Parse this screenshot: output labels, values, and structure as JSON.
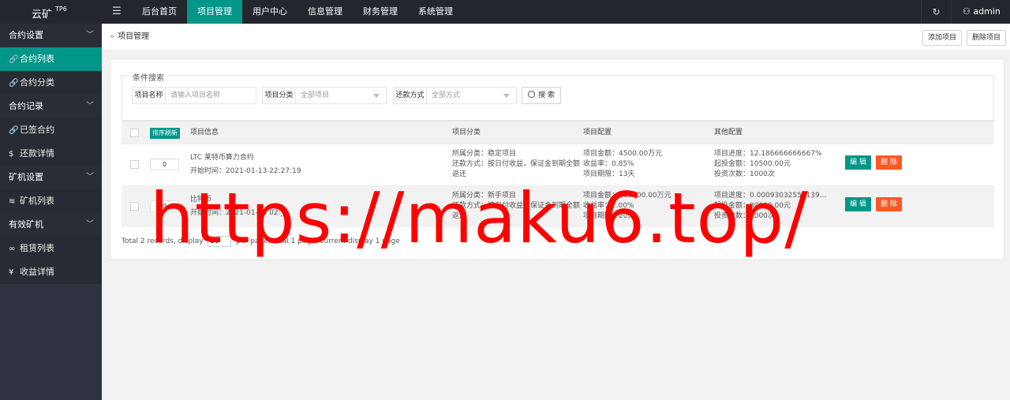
{
  "app": {
    "name": "云矿",
    "version": "TP6"
  },
  "topnav": {
    "toggle_icon": "menu-icon",
    "items": [
      {
        "label": "后台首页",
        "active": false
      },
      {
        "label": "项目管理",
        "active": true
      },
      {
        "label": "用户中心",
        "active": false
      },
      {
        "label": "信息管理",
        "active": false
      },
      {
        "label": "财务管理",
        "active": false
      },
      {
        "label": "系统管理",
        "active": false
      }
    ],
    "refresh_icon": "refresh-icon",
    "user": "admin"
  },
  "sidebar": {
    "groups": [
      {
        "label": "合约设置"
      },
      {
        "label": "合约记录"
      },
      {
        "label": "矿机设置"
      },
      {
        "label": "有效矿机"
      }
    ],
    "items": [
      {
        "label": "合约列表",
        "icon": "link-icon",
        "active": true
      },
      {
        "label": "合约分类",
        "icon": "link-icon"
      },
      {
        "label": "已签合约",
        "icon": "link-icon"
      },
      {
        "label": "还款详情",
        "icon": "dollar-icon"
      },
      {
        "label": "矿机列表",
        "icon": "stack-icon"
      },
      {
        "label": "租赁列表",
        "icon": "chain-icon"
      },
      {
        "label": "收益详情",
        "icon": "yen-icon"
      }
    ]
  },
  "breadcrumb": {
    "label": "项目管理"
  },
  "toolbar": {
    "add_label": "添加项目",
    "delete_label": "删除项目"
  },
  "search": {
    "legend": "条件搜索",
    "name_label": "项目名称",
    "name_placeholder": "请输入项目名称",
    "category_label": "项目分类",
    "category_value": "全部项目",
    "repay_label": "还款方式",
    "repay_value": "全部方式",
    "button_label": "搜 索"
  },
  "table": {
    "sort_badge": "排序刷新",
    "headers": [
      "项目信息",
      "项目分类",
      "项目配置",
      "其他配置"
    ],
    "rows": [
      {
        "sort": "0",
        "name": "LTC 莱特币算力合约",
        "start": "开始时间：2021-01-13 22:27:19",
        "category": "所属分类：稳定项目",
        "repay1": "还款方式：按日付收益，保证金到期全额",
        "repay2": "返还",
        "amount": "项目金额：4500.00万元",
        "rate": "收益率：0.85%",
        "term": "项目期限：13天",
        "progress": "项目进度：12.186666666667%",
        "min": "起投金额：10500.00元",
        "count": "投资次数：1000次",
        "edit": "编 辑",
        "del": "删 除"
      },
      {
        "sort": "0",
        "name": "比特币",
        "start": "开始时间：2021-01-13 02:__",
        "category": "所属分类：新手项目",
        "repay1": "还款方式：按日付收益，保证金到期全额",
        "repay2": "返还",
        "amount": "项目金额：860000.00万元",
        "rate": "收益率：2.00%",
        "term": "项目期限：20天",
        "progress": "项目进度：0.00093032558139...",
        "min": "起投金额：80000.00元",
        "count": "投资次数：1000次",
        "edit": "编 辑",
        "del": "删 除"
      }
    ]
  },
  "pager": {
    "text_before": "Total 2 records, display",
    "size": "20",
    "text_after": "per page, total 1 page, current display 1 page"
  },
  "watermark": "https://maku6.top/"
}
